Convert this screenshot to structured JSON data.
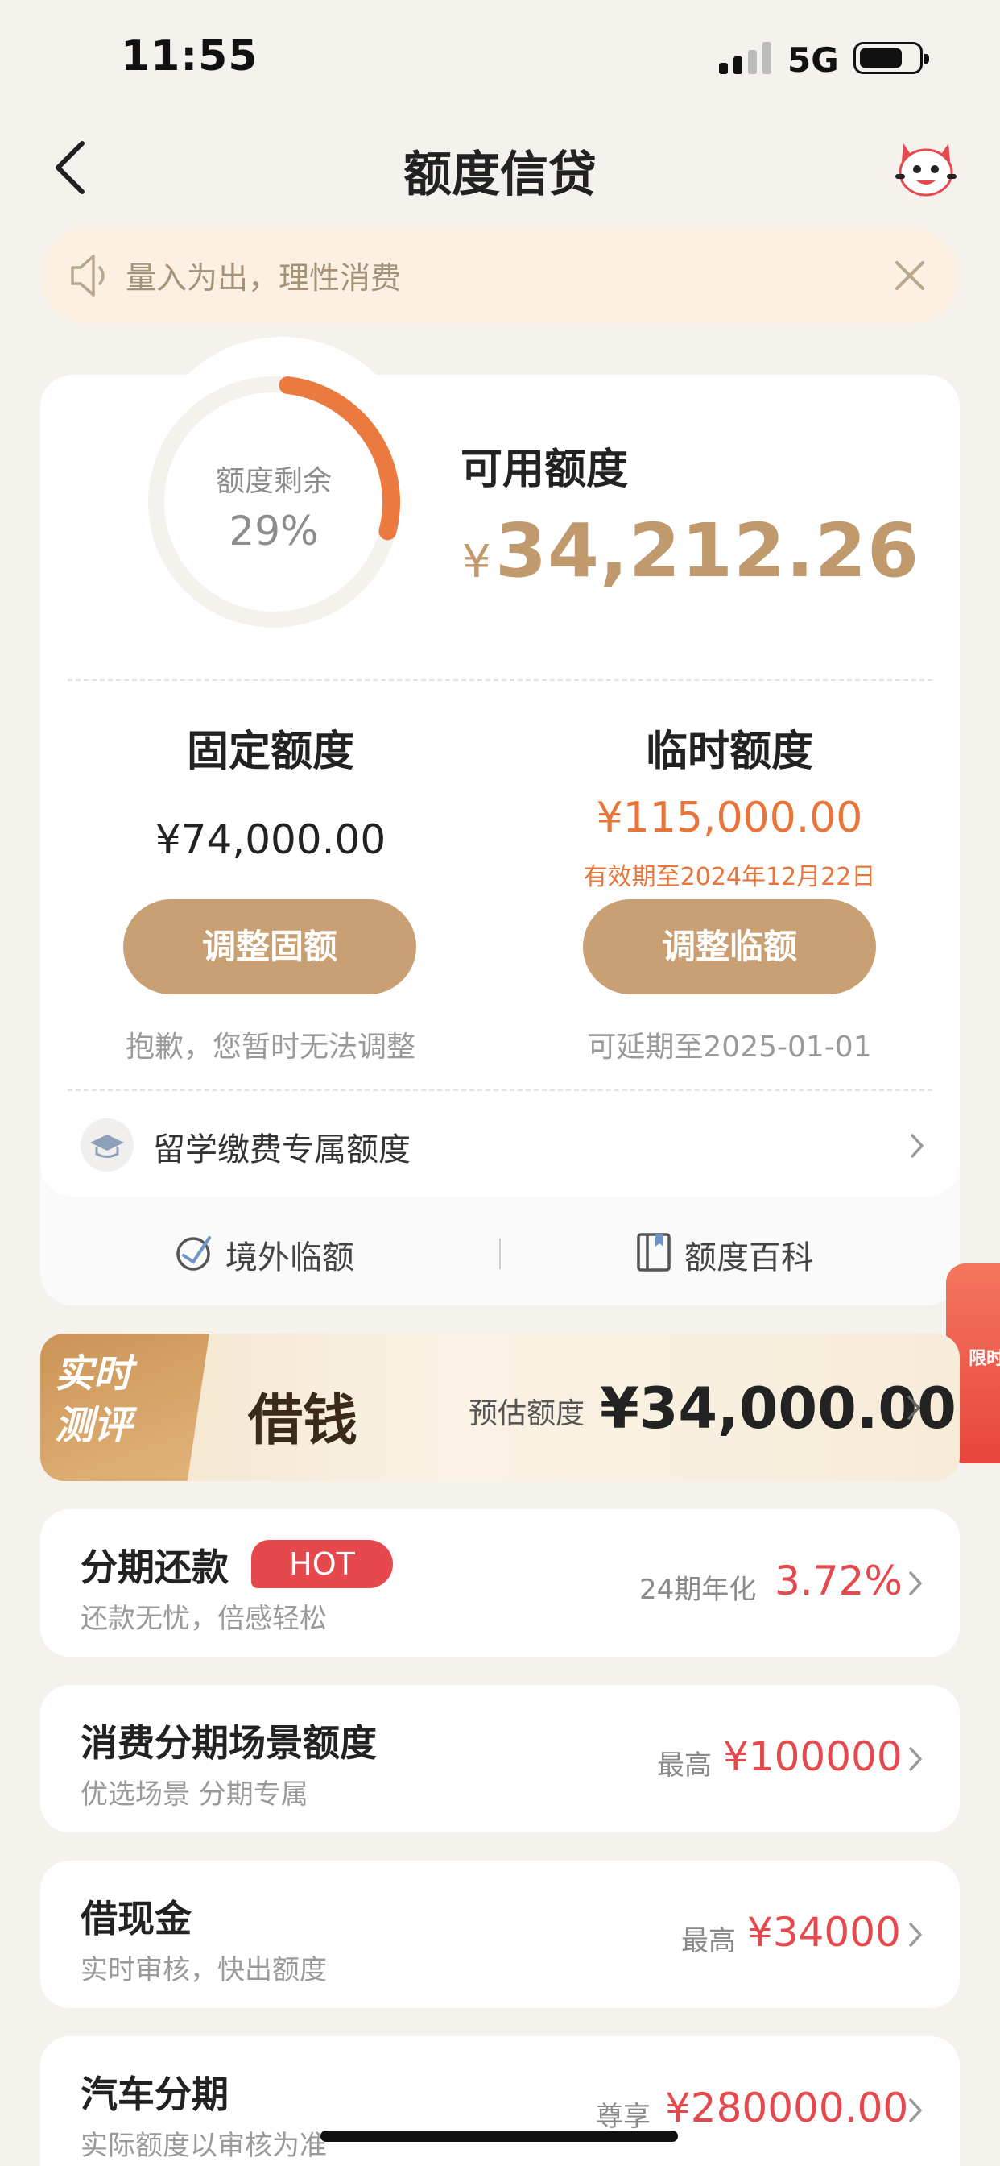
{
  "status": {
    "time": "11:55",
    "network": "5G"
  },
  "nav": {
    "title": "额度信贷"
  },
  "notice": {
    "text": "量入为出，理性消费"
  },
  "quota": {
    "gauge_label": "额度剩余",
    "gauge_percent": "29%",
    "gauge_value": 0.29,
    "available_label": "可用额度",
    "currency": "¥",
    "available_amount": "34,212.26"
  },
  "fixed": {
    "title": "固定额度",
    "amount": "¥74,000.00",
    "button": "调整固额",
    "hint": "抱歉，您暂时无法调整"
  },
  "temp": {
    "title": "临时额度",
    "amount": "¥115,000.00",
    "expiry": "有效期至2024年12月22日",
    "button": "调整临额",
    "hint": "可延期至2025-01-01"
  },
  "study": {
    "label": "留学缴费专属额度"
  },
  "links": {
    "overseas": "境外临额",
    "wiki": "额度百科"
  },
  "promo": {
    "text": "限时"
  },
  "loan": {
    "tag_line1": "实时",
    "tag_line2": "测评",
    "title": "借钱",
    "estimate_label": "预估额度",
    "estimate_amount": "¥34,000.00"
  },
  "items": [
    {
      "title": "分期还款",
      "badge": "HOT",
      "subtitle": "还款无忧，倍感轻松",
      "right_label": "24期年化",
      "right_value": "3.72%"
    },
    {
      "title": "消费分期场景额度",
      "subtitle": "优选场景 分期专属",
      "right_label": "最高",
      "right_value": "¥100000"
    },
    {
      "title": "借现金",
      "subtitle": "实时审核，快出额度",
      "right_label": "最高",
      "right_value": "¥34000"
    },
    {
      "title": "汽车分期",
      "subtitle": "实际额度以审核为准",
      "right_label": "尊享",
      "right_value": "¥280000.00"
    }
  ],
  "colors": {
    "accent_gold": "#c9a073",
    "orange": "#e9753a",
    "red": "#e5484d",
    "background": "#f5f1ec"
  }
}
